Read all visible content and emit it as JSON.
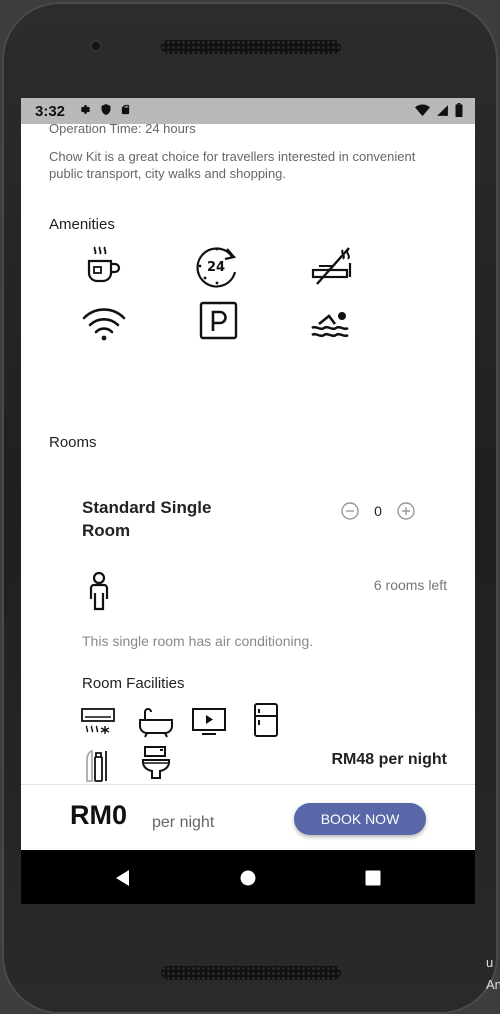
{
  "status": {
    "time": "3:32"
  },
  "hotel": {
    "operation_time": "Operation Time: 24 hours",
    "description": "Chow Kit is a great choice for travellers interested in convenient public transport, city walks and shopping."
  },
  "amenities": {
    "heading": "Amenities",
    "icons": [
      "coffee-icon",
      "24-hour-icon",
      "no-smoking-icon",
      "wifi-icon",
      "parking-icon",
      "swimming-icon"
    ]
  },
  "rooms": {
    "heading": "Rooms",
    "items": [
      {
        "name": "Standard Single Room",
        "quantity": "0",
        "rooms_left": "6 rooms left",
        "description": "This single room has air conditioning.",
        "facilities_heading": "Room Facilities",
        "facility_icons": [
          "air-conditioner-icon",
          "bathtub-icon",
          "tv-icon",
          "fridge-icon",
          "toiletries-icon",
          "toilet-icon"
        ],
        "price": "RM48 per night"
      }
    ]
  },
  "booking": {
    "total": "RM0",
    "per_night": "per night",
    "book_label": "BOOK NOW"
  },
  "colors": {
    "accent": "#5767a8",
    "statusbar": "#b9b9b9"
  },
  "background": {
    "partial_text_1": "u",
    "partial_text_2": "An"
  }
}
